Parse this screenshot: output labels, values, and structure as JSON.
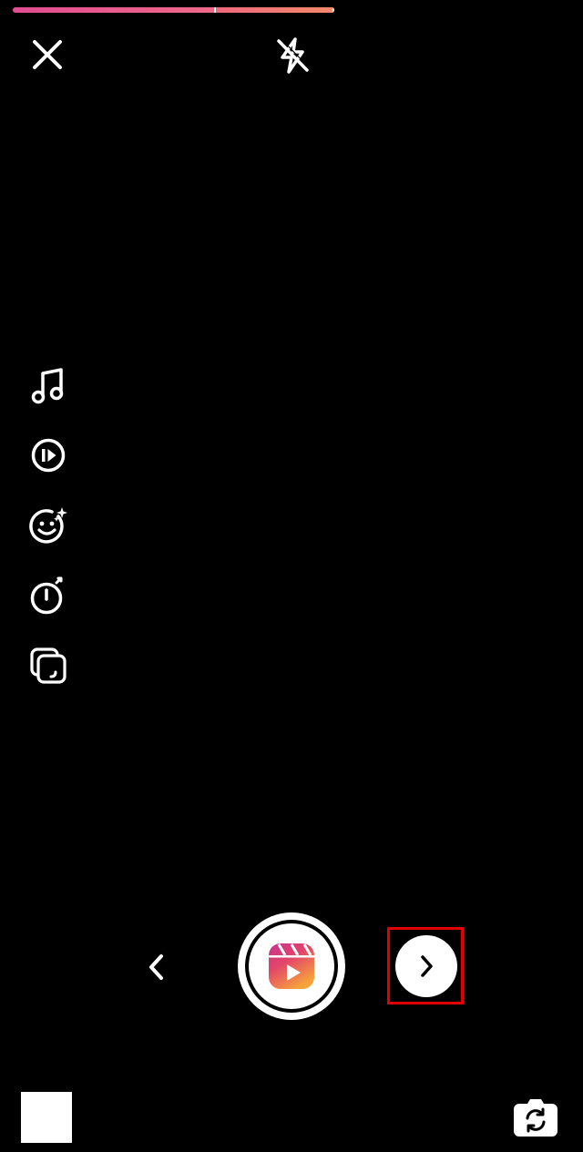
{
  "app": "Reels camera",
  "progress": {
    "segments": [
      {
        "fraction": 0.626,
        "color": "#e24d91"
      },
      {
        "fraction": 0.363,
        "color": "#f28a6a"
      }
    ]
  },
  "top_bar": {
    "close_icon": "close-icon",
    "flash_icon": "flash-off-icon"
  },
  "side_tools": [
    {
      "name": "audio",
      "icon": "music-note-icon"
    },
    {
      "name": "speed",
      "icon": "speed-play-icon"
    },
    {
      "name": "effects",
      "icon": "sparkle-face-icon"
    },
    {
      "name": "timer",
      "icon": "timer-icon"
    },
    {
      "name": "layout",
      "icon": "layout-icon"
    }
  ],
  "bottom_controls": {
    "prev_icon": "chevron-left-icon",
    "shutter_icon": "reels-logo-icon",
    "next_icon": "chevron-right-icon",
    "gallery_icon": "gallery-thumbnail",
    "flip_icon": "flip-camera-icon"
  },
  "colors": {
    "background": "#000000",
    "accent_start": "#e24d91",
    "accent_end": "#f28a6a",
    "highlight": "#e00000"
  }
}
